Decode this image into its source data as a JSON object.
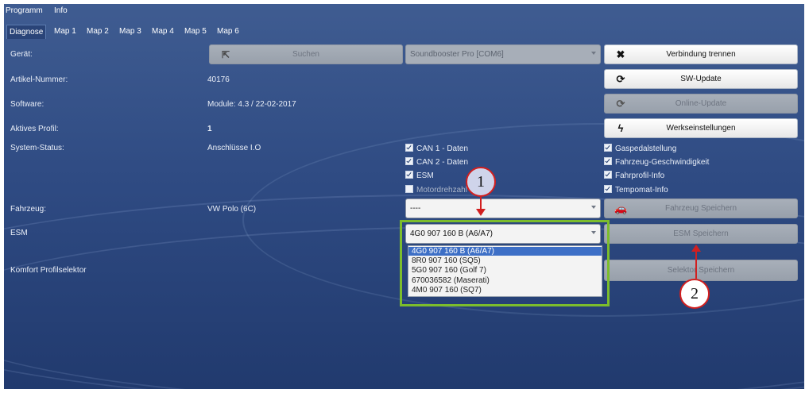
{
  "menubar": {
    "items": [
      "Programm",
      "Info"
    ]
  },
  "tabs": [
    "Diagnose",
    "Map 1",
    "Map 2",
    "Map 3",
    "Map 4",
    "Map 5",
    "Map 6"
  ],
  "labels": {
    "geraet": "Gerät:",
    "artikel": "Artikel-Nummer:",
    "software": "Software:",
    "profil": "Aktives Profil:",
    "status": "System-Status:",
    "fahrzeug": "Fahrzeug:",
    "esm": "ESM",
    "komfort": "Komfort Profilselektor"
  },
  "values": {
    "artikel": "40176",
    "software": "Module: 4.3 / 22-02-2017",
    "profil": "1",
    "status": "Anschlüsse I.O",
    "fahrzeug": "VW Polo (6C)"
  },
  "buttons": {
    "suchen": "Suchen",
    "verbindung": "Verbindung trennen",
    "swupdate": "SW-Update",
    "online": "Online-Update",
    "werk": "Werkseinstellungen",
    "fahrzeug_speichern": "Fahrzeug Speichern",
    "esm_speichern": "ESM Speichern",
    "selektor_speichern": "Selektor Speichern"
  },
  "combos": {
    "device": "Soundbooster Pro [COM6]",
    "vehicle": "----",
    "esm": "4G0 907 160 B (A6/A7)"
  },
  "checks_col1": [
    {
      "label": "CAN 1 - Daten",
      "checked": true
    },
    {
      "label": "CAN 2 - Daten",
      "checked": true
    },
    {
      "label": "ESM",
      "checked": true
    },
    {
      "label": "Motordrehzahl",
      "checked": false
    }
  ],
  "checks_col2": [
    {
      "label": "Gaspedalstellung",
      "checked": true
    },
    {
      "label": "Fahrzeug-Geschwindigkeit",
      "checked": true
    },
    {
      "label": "Fahrprofil-Info",
      "checked": true
    },
    {
      "label": "Tempomat-Info",
      "checked": true
    }
  ],
  "esm_options": [
    "4G0 907 160 B (A6/A7)",
    "8R0 907 160 (SQ5)",
    "5G0 907 160 (Golf 7)",
    "670036582 (Maserati)",
    "4M0 907 160 (SQ7)"
  ],
  "callouts": [
    "1",
    "2"
  ],
  "icons": {
    "suchen": "export-icon",
    "verbindung": "close-icon",
    "swupdate": "refresh-icon",
    "online": "refresh-icon",
    "werk": "lightning-icon",
    "fahrzeug": "car-icon"
  },
  "colors": {
    "highlight_frame": "#7cbd2c",
    "callout_red": "#d21f1f",
    "selection": "#3d6fc6"
  }
}
